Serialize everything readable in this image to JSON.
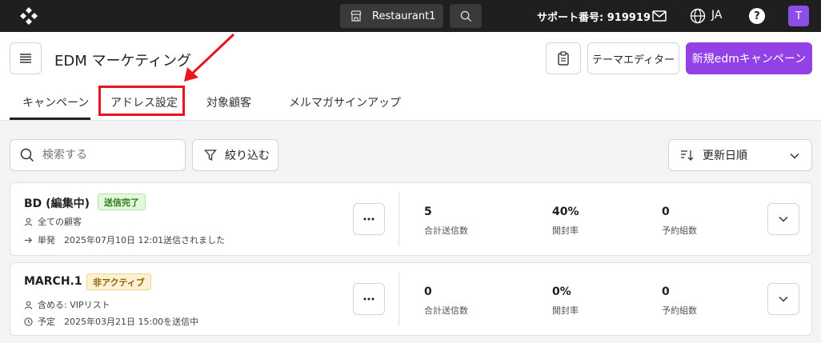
{
  "topbar": {
    "store_name": "Restaurant1",
    "support_text": "サポート番号: 919919",
    "language": "JA",
    "help_label": "?",
    "avatar_initial": "T"
  },
  "header": {
    "title": "EDM マーケティング",
    "theme_editor_label": "テーマエディター",
    "new_campaign_label": "新規edmキャンペーン"
  },
  "tabs": [
    {
      "label": "キャンペーン",
      "active": true
    },
    {
      "label": "アドレス設定",
      "active": false
    },
    {
      "label": "対象顧客",
      "active": false
    },
    {
      "label": "メルマガサインアップ",
      "active": false
    }
  ],
  "filters": {
    "search_placeholder": "検索する",
    "filter_label": "絞り込む",
    "sort_label": "更新日順"
  },
  "campaigns": [
    {
      "title": "BD (編集中)",
      "status": "送信完了",
      "audience": "全ての顧客",
      "schedule": "単発　2025年07月10日 12:01送信されました",
      "stats": [
        {
          "value": "5",
          "label": "合計送信数"
        },
        {
          "value": "40%",
          "label": "開封率"
        },
        {
          "value": "0",
          "label": "予約組数"
        }
      ]
    },
    {
      "title": "MARCH.1",
      "status": "非アクティブ",
      "audience": "含める: VIPリスト",
      "schedule": "予定　2025年03月21日 15:00を送信中",
      "stats": [
        {
          "value": "0",
          "label": "合計送信数"
        },
        {
          "value": "0%",
          "label": "開封率"
        },
        {
          "value": "0",
          "label": "予約組数"
        }
      ]
    }
  ],
  "colors": {
    "topbar_bg": "#1f1f1f",
    "primary": "#9141e6",
    "annotation": "#e8141e",
    "status_sent": "#2a7d17",
    "status_inactive": "#8a6400"
  }
}
